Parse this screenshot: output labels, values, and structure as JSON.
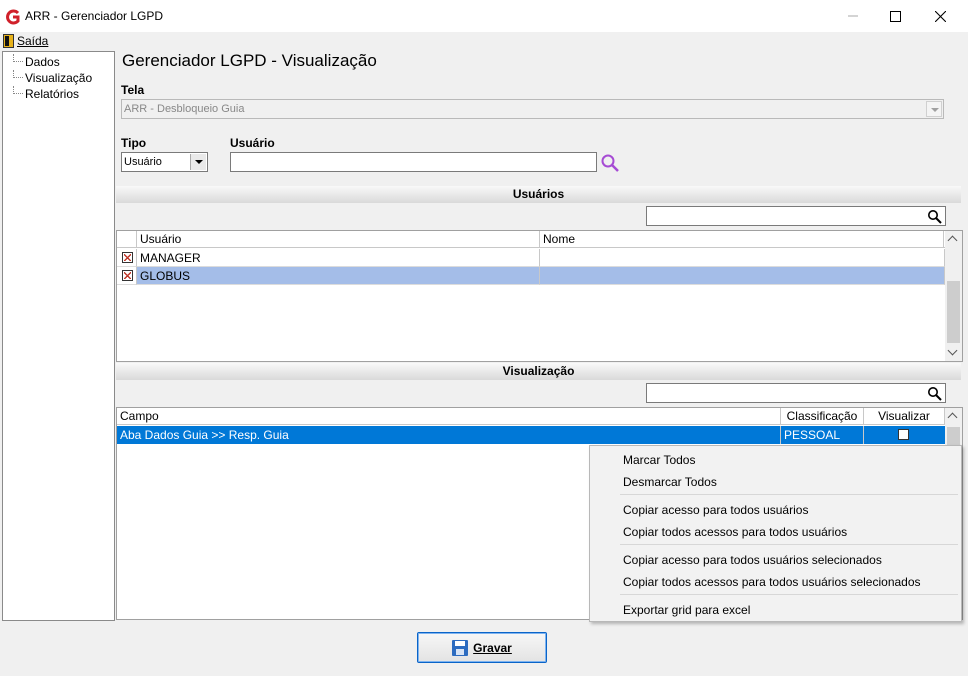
{
  "window": {
    "title": "ARR - Gerenciador LGPD"
  },
  "menubar": {
    "items": [
      {
        "label": "Saída"
      }
    ]
  },
  "tree": {
    "items": [
      {
        "label": "Dados"
      },
      {
        "label": "Visualização"
      },
      {
        "label": "Relatórios"
      }
    ]
  },
  "main": {
    "title": "Gerenciador LGPD - Visualização",
    "tela": {
      "label": "Tela",
      "value": "ARR - Desbloqueio Guia"
    },
    "tipo": {
      "label": "Tipo",
      "value": "Usuário"
    },
    "usuario": {
      "label": "Usuário",
      "value": ""
    }
  },
  "usuarios_section": {
    "header": "Usuários",
    "search_value": "",
    "columns": [
      "Usuário",
      "Nome"
    ],
    "rows": [
      {
        "checked": true,
        "usuario": "MANAGER",
        "nome": ""
      },
      {
        "checked": true,
        "usuario": "GLOBUS",
        "nome": ""
      }
    ]
  },
  "visualizacao_section": {
    "header": "Visualização",
    "search_value": "",
    "columns": [
      "Campo",
      "Classificação",
      "Visualizar"
    ],
    "rows": [
      {
        "campo": "Aba Dados Guia >> Resp. Guia",
        "classificacao": "PESSOAL",
        "visualizar": false
      }
    ]
  },
  "context_menu": {
    "items": [
      "Marcar Todos",
      "Desmarcar Todos",
      "Copiar acesso para todos usuários",
      "Copiar todos acessos para todos usuários",
      "Copiar acesso para todos usuários selecionados",
      "Copiar todos acessos para todos usuários selecionados",
      "Exportar grid para excel"
    ]
  },
  "footer": {
    "save_label": "Gravar"
  },
  "colors": {
    "selection_blue": "#0078d7",
    "row_highlight": "#a4bde8",
    "accent_red": "#c0392b"
  }
}
